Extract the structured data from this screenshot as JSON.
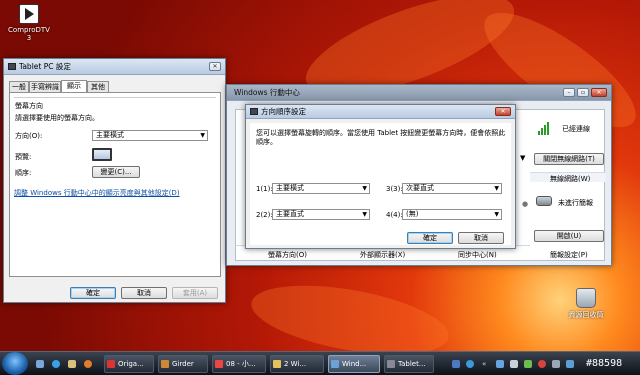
{
  "desktop": {
    "icons": [
      {
        "label": "ComproDTV 3"
      },
      {
        "label": "資源回收筒"
      }
    ],
    "watermark": "#88598"
  },
  "tablet_settings": {
    "title": "Tablet PC 設定",
    "tabs": [
      "一般",
      "手寫辨識",
      "顯示",
      "其他"
    ],
    "group_title": "螢幕方向",
    "instruction": "請選擇要使用的螢幕方向。",
    "orientation_label": "方向(O):",
    "orientation_value": "主要橫式",
    "preview_label": "預覽:",
    "order_label": "順序:",
    "change_button": "變更(C)...",
    "link_text": "調整 Windows 行動中心中的顯示亮度與其他設定(D)",
    "ok": "確定",
    "cancel": "取消",
    "apply": "套用(A)"
  },
  "mobility_center": {
    "title": "Windows 行動中心",
    "wireless_status": "已經連線",
    "wireless_button": "關閉無線網路(T)",
    "wireless_label": "無線網路(W)",
    "presentation_status": "未進行簡報",
    "presentation_button": "開啟(U)",
    "presentation_label": "簡報設定(P)",
    "bottom_labels": [
      "螢幕方向(O)",
      "外部顯示器(X)",
      "同步中心(N)"
    ]
  },
  "order_dialog": {
    "title": "方向順序設定",
    "description": "您可以選擇螢幕旋轉的順序。當您使用 Tablet 按鈕變更螢幕方向時，便會依照此順序。",
    "slots": [
      {
        "label": "1(1):",
        "value": "主要橫式"
      },
      {
        "label": "3(3):",
        "value": "次要直式"
      },
      {
        "label": "2(2):",
        "value": "主要直式"
      },
      {
        "label": "4(4):",
        "value": "(無)"
      }
    ],
    "ok": "確定",
    "cancel": "取消"
  },
  "taskbar": {
    "items": [
      "Origa...",
      "Girder",
      "08 - 小...",
      "2 Wi...",
      "Wind...",
      "Tablet..."
    ],
    "active_index": 4
  },
  "colors": {
    "link": "#0b4ea2",
    "taskbar": "#1a1f27",
    "wallpaper_red": "#d8300a"
  }
}
